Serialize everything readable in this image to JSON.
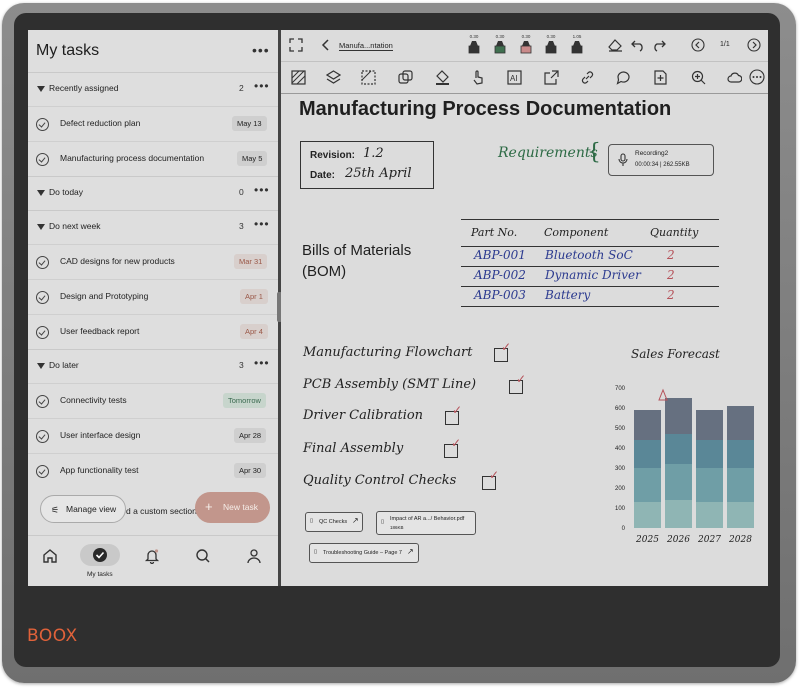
{
  "left_panel": {
    "title": "My tasks",
    "sections": [
      {
        "label": "Recently assigned",
        "count": "2"
      },
      {
        "label": "Do today",
        "count": "0"
      },
      {
        "label": "Do next week",
        "count": "3"
      },
      {
        "label": "Do later",
        "count": "3"
      }
    ],
    "tasks": [
      {
        "name": "Defect reduction plan",
        "date": "May 13",
        "style": "plain"
      },
      {
        "name": "Manufacturing process documentation",
        "date": "May 5",
        "style": "plain"
      },
      {
        "name": "CAD designs for new products",
        "date": "Mar 31",
        "style": "red"
      },
      {
        "name": "Design and Prototyping",
        "date": "Apr 1",
        "style": "red"
      },
      {
        "name": "User feedback report",
        "date": "Apr 4",
        "style": "red"
      },
      {
        "name": "Connectivity tests",
        "date": "Tomorrow",
        "style": "green"
      },
      {
        "name": "User interface design",
        "date": "Apr 28",
        "style": "plain"
      },
      {
        "name": "App functionality test",
        "date": "Apr 30",
        "style": "plain"
      }
    ],
    "manage_view": "Manage view",
    "add_section": "d a custom section",
    "new_task": "New task",
    "nav_active_label": "My tasks"
  },
  "toolbar": {
    "breadcrumb": "Manufa...ntation",
    "page_indicator": "1/1",
    "pen_sizes": [
      "0.30",
      "0.30",
      "0.30",
      "0.30",
      "1.05"
    ],
    "pen_colors": [
      "#333333",
      "#3f6f4f",
      "#c98a8a",
      "#333333",
      "#333333"
    ]
  },
  "document": {
    "title": "Manufacturing Process Documentation",
    "revision_label": "Revision:",
    "revision_value": "1.2",
    "date_label": "Date:",
    "date_value": "25th April",
    "requirements": "Requirements",
    "recording": {
      "name": "Recording2",
      "meta": "00:00:34 | 262.55KB"
    },
    "bom_title_line1": "Bills of Materials",
    "bom_title_line2": "(BOM)",
    "bom_headers": [
      "Part No.",
      "Component",
      "Quantity"
    ],
    "bom_rows": [
      {
        "part": "ABP-001",
        "component": "Bluetooth SoC",
        "qty": "2"
      },
      {
        "part": "ABP-002",
        "component": "Dynamic Driver",
        "qty": "2"
      },
      {
        "part": "ABP-003",
        "component": "Battery",
        "qty": "2"
      }
    ],
    "checklist": [
      "Manufacturing Flowchart",
      "PCB Assembly (SMT Line)",
      "Driver Calibration",
      "Final Assembly",
      "Quality Control Checks"
    ],
    "links": [
      "QC Checks",
      "Impact of AR a.../ Behavior.pdf",
      "Troubleshooting Guide – Page 7"
    ],
    "link_sub": "186KB"
  },
  "chart_data": {
    "type": "bar",
    "title": "Sales Forecast",
    "categories": [
      "2025",
      "2026",
      "2027",
      "2028"
    ],
    "y_ticks": [
      "0",
      "100",
      "200",
      "300",
      "400",
      "500",
      "600",
      "700"
    ],
    "ylim": [
      0,
      700
    ],
    "stacked": true,
    "series": [
      {
        "values": [
          130,
          140,
          130,
          130
        ]
      },
      {
        "values": [
          170,
          180,
          170,
          170
        ]
      },
      {
        "values": [
          140,
          150,
          140,
          140
        ]
      },
      {
        "values": [
          150,
          180,
          150,
          170
        ]
      }
    ],
    "colors": [
      "#8fb5b4",
      "#6f9ea6",
      "#5a8797",
      "#667080"
    ],
    "grid": false,
    "annotation": "triangle marker above 2026"
  }
}
